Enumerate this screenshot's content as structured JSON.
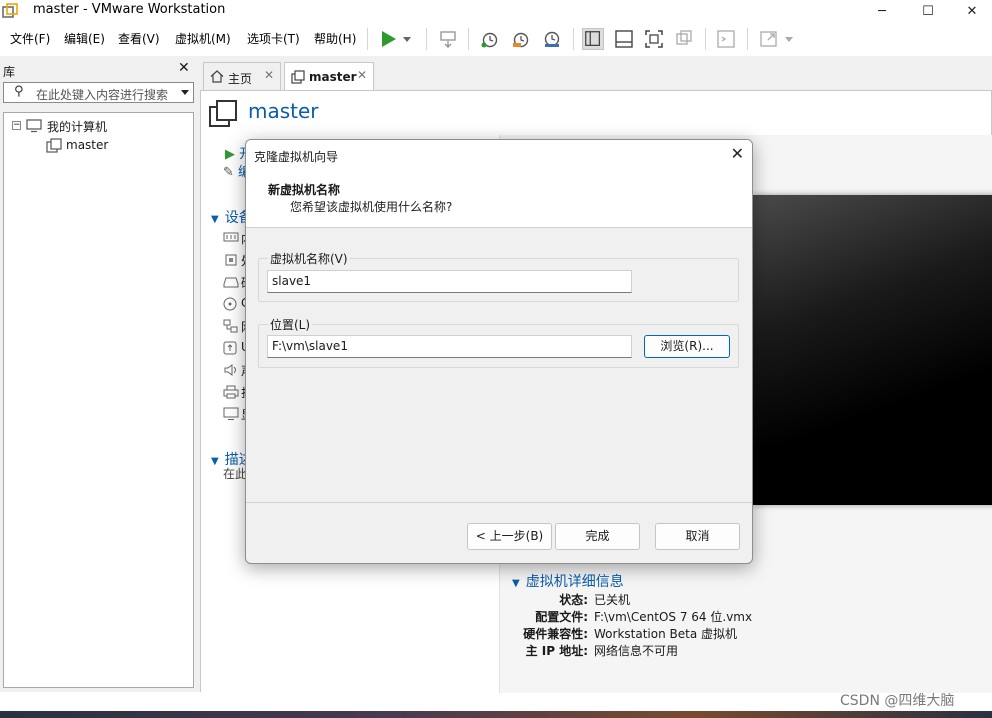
{
  "window": {
    "title": "master - VMware Workstation",
    "minimize": "─",
    "maximize": "☐",
    "close": "✕"
  },
  "menu": {
    "items": [
      "文件(F)",
      "编辑(E)",
      "查看(V)",
      "虚拟机(M)",
      "选项卡(T)",
      "帮助(H)"
    ]
  },
  "toolbar": {
    "icons": [
      "play-icon",
      "dropdown-arrow-icon",
      "send-ctrl-alt-del-icon",
      "snapshot-take-icon",
      "snapshot-revert-icon",
      "snapshot-manager-icon",
      "library-view-icon",
      "thumbnail-bar-icon",
      "fullscreen-icon",
      "unity-icon",
      "console-view-icon",
      "stretch-guest-icon"
    ]
  },
  "library": {
    "title": "库",
    "close": "✕",
    "search_placeholder": "在此处键入内容进行搜索",
    "tree": {
      "root_label": "我的计算机",
      "root_toggle": "−",
      "child_label": "master"
    }
  },
  "tabs": [
    {
      "label": "主页",
      "close": "✕"
    },
    {
      "label": "master",
      "close": "✕"
    }
  ],
  "vm": {
    "name": "master",
    "section_devices_label": "设备",
    "section_description_label": "描述",
    "description_partial": "在此",
    "commands_partial": [
      "开",
      "编"
    ],
    "device_partial_labels": [
      "内",
      "处",
      "硬",
      "C",
      "网",
      "U",
      "声",
      "打",
      "显"
    ]
  },
  "details": {
    "header": "虚拟机详细信息",
    "rows": [
      {
        "key": "状态:",
        "value": "已关机"
      },
      {
        "key": "配置文件:",
        "value": "F:\\vm\\CentOS 7 64 位.vmx"
      },
      {
        "key": "硬件兼容性:",
        "value": "Workstation Beta 虚拟机"
      },
      {
        "key": "主 IP 地址:",
        "value": "网络信息不可用"
      }
    ]
  },
  "dialog": {
    "title": "克隆虚拟机向导",
    "close": "✕",
    "heading": "新虚拟机名称",
    "subheading": "您希望该虚拟机使用什么名称?",
    "name_group_label": "虚拟机名称(V)",
    "name_value": "slave1",
    "location_group_label": "位置(L)",
    "location_value": "F:\\vm\\slave1",
    "browse_label": "浏览(R)...",
    "back_label": "< 上一步(B)",
    "finish_label": "完成",
    "cancel_label": "取消"
  },
  "watermark": "CSDN @四维大脑",
  "colors": {
    "accent": "#0b5cab",
    "play_green": "#2e9a2e",
    "dialog_bg": "#f0f0f0",
    "primary_border": "#0067c0"
  }
}
